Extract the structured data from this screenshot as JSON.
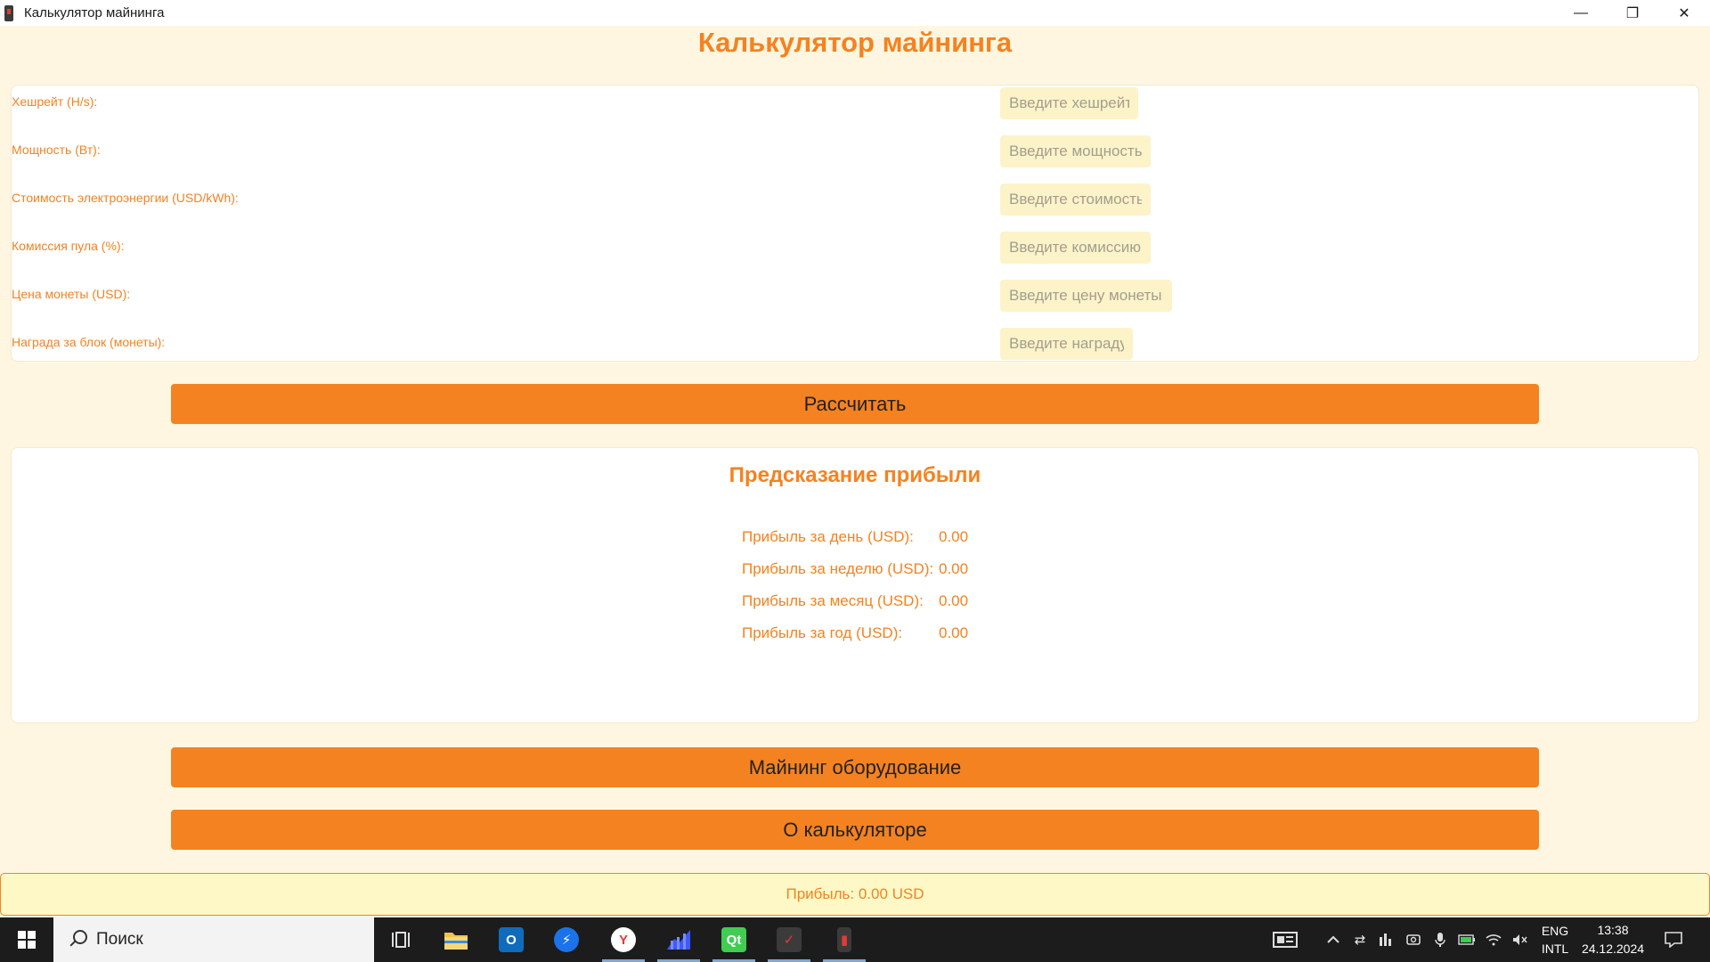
{
  "window": {
    "title": "Калькулятор майнинга",
    "minimize_glyph": "—",
    "restore_glyph": "❐",
    "close_glyph": "✕"
  },
  "header": {
    "title": "Калькулятор майнинга"
  },
  "inputs": [
    {
      "label": "Хешрейт (H/s):",
      "placeholder": "Введите хешрейт",
      "value": ""
    },
    {
      "label": "Мощность (Вт):",
      "placeholder": "Введите мощность",
      "value": ""
    },
    {
      "label": "Стоимость электроэнергии (USD/kWh):",
      "placeholder": "Введите стоимость",
      "value": ""
    },
    {
      "label": "Комиссия пула (%):",
      "placeholder": "Введите комиссию",
      "value": ""
    },
    {
      "label": "Цена монеты (USD):",
      "placeholder": "Введите цену монеты",
      "value": ""
    },
    {
      "label": "Награда за блок (монеты):",
      "placeholder": "Введите награду",
      "value": ""
    }
  ],
  "calculate_button": "Рассчитать",
  "results": {
    "title": "Предсказание прибыли",
    "rows": [
      {
        "label": "Прибыль за день (USD):",
        "value": "0.00"
      },
      {
        "label": "Прибыль за неделю (USD):",
        "value": "0.00"
      },
      {
        "label": "Прибыль за месяц (USD):",
        "value": "0.00"
      },
      {
        "label": "Прибыль за год (USD):",
        "value": "0.00"
      }
    ]
  },
  "equipment_button": "Майнинг оборудование",
  "about_button": "О калькуляторе",
  "status": "Прибыль: 0.00 USD",
  "taskbar": {
    "search_placeholder": "Поиск",
    "language_top": "ENG",
    "language_bottom": "INTL",
    "time": "13:38",
    "date": "24.12.2024"
  },
  "colors": {
    "accent": "#f58220",
    "background": "#fef6e0",
    "input_bg": "#fcf3c9",
    "status_bg": "#fef8c6"
  }
}
